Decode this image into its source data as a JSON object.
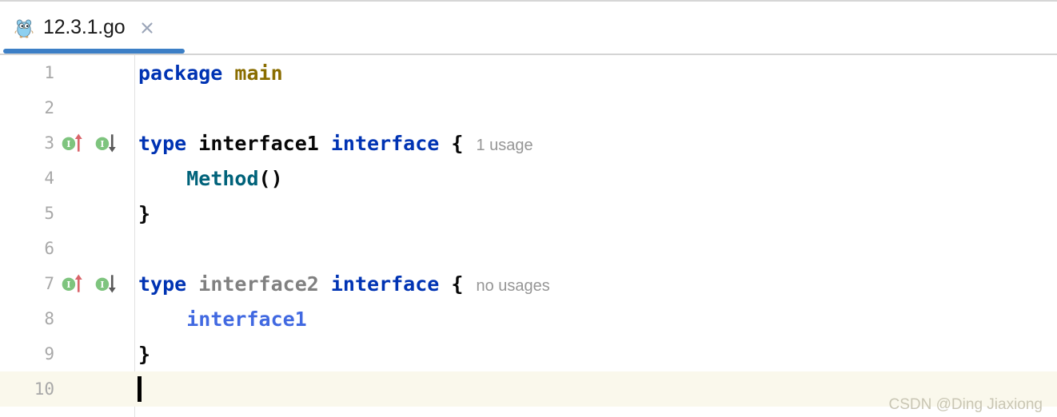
{
  "tab": {
    "title": "12.3.1.go",
    "icon": "go-gopher-icon",
    "close_label": "×",
    "accent_color": "#3c7fc6"
  },
  "editor": {
    "language": "go",
    "caret_line": 10,
    "current_line_color": "#faf8ec",
    "lines": [
      {
        "number": "1",
        "markers": [],
        "tokens": [
          {
            "text": "package",
            "style": "kw"
          },
          {
            "text": " ",
            "style": "punct"
          },
          {
            "text": "main",
            "style": "pkg"
          }
        ],
        "hint": ""
      },
      {
        "number": "2",
        "markers": [],
        "tokens": [],
        "hint": ""
      },
      {
        "number": "3",
        "markers": [
          "implemented-by-icon",
          "implements-icon"
        ],
        "tokens": [
          {
            "text": "type",
            "style": "kw"
          },
          {
            "text": " ",
            "style": "punct"
          },
          {
            "text": "interface1",
            "style": "ident"
          },
          {
            "text": " ",
            "style": "punct"
          },
          {
            "text": "interface",
            "style": "kw"
          },
          {
            "text": " ",
            "style": "punct"
          },
          {
            "text": "{",
            "style": "punct"
          }
        ],
        "hint": "1 usage"
      },
      {
        "number": "4",
        "markers": [],
        "tokens": [
          {
            "text": "    ",
            "style": "punct"
          },
          {
            "text": "Method",
            "style": "meth"
          },
          {
            "text": "()",
            "style": "punct"
          }
        ],
        "hint": ""
      },
      {
        "number": "5",
        "markers": [],
        "tokens": [
          {
            "text": "}",
            "style": "punct"
          }
        ],
        "hint": ""
      },
      {
        "number": "6",
        "markers": [],
        "tokens": [],
        "hint": ""
      },
      {
        "number": "7",
        "markers": [
          "implemented-by-icon",
          "implements-icon"
        ],
        "tokens": [
          {
            "text": "type",
            "style": "kw"
          },
          {
            "text": " ",
            "style": "punct"
          },
          {
            "text": "interface2",
            "style": "dim"
          },
          {
            "text": " ",
            "style": "punct"
          },
          {
            "text": "interface",
            "style": "kw"
          },
          {
            "text": " ",
            "style": "punct"
          },
          {
            "text": "{",
            "style": "punct"
          }
        ],
        "hint": "no usages"
      },
      {
        "number": "8",
        "markers": [],
        "tokens": [
          {
            "text": "    ",
            "style": "punct"
          },
          {
            "text": "interface1",
            "style": "ref"
          }
        ],
        "hint": ""
      },
      {
        "number": "9",
        "markers": [],
        "tokens": [
          {
            "text": "}",
            "style": "punct"
          }
        ],
        "hint": ""
      },
      {
        "number": "10",
        "markers": [],
        "tokens": [],
        "hint": ""
      }
    ]
  },
  "watermark": {
    "text": "CSDN @Ding Jiaxiong"
  }
}
